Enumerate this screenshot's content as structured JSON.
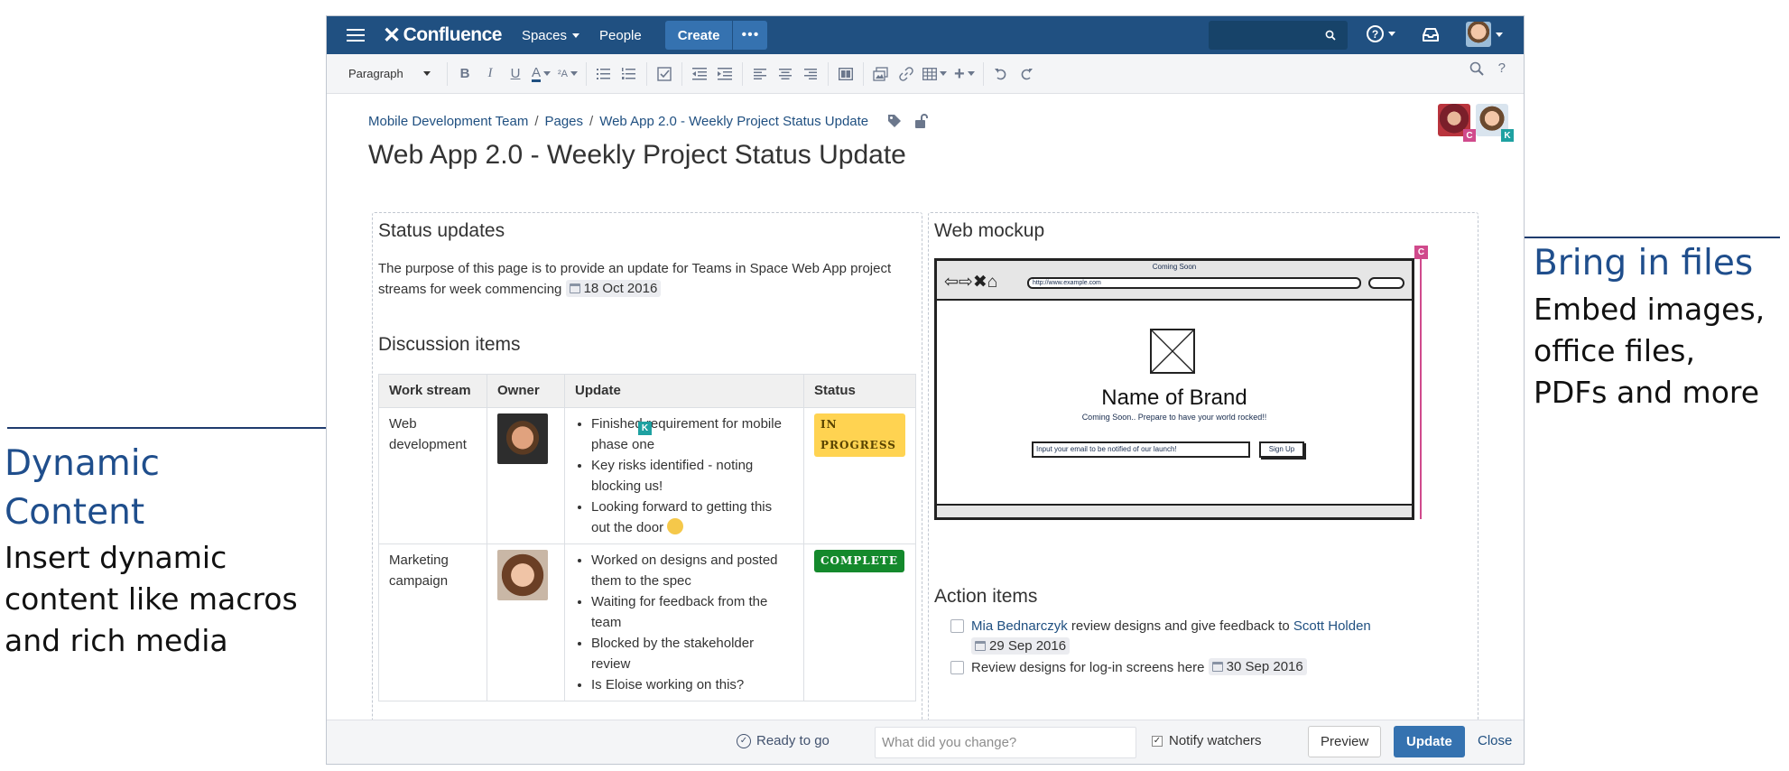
{
  "annotations": {
    "left": {
      "title_lines": [
        "Dynamic",
        "Content"
      ],
      "body_lines": [
        "Insert dynamic",
        "content like macros",
        "and rich media"
      ]
    },
    "right": {
      "title_lines": [
        "Bring in files"
      ],
      "body_lines": [
        "Embed images,",
        "office files,",
        "PDFs and more"
      ]
    }
  },
  "nav": {
    "logo": "Confluence",
    "spaces": "Spaces",
    "people": "People",
    "create": "Create",
    "more": "•••"
  },
  "toolbar": {
    "paragraph": "Paragraph"
  },
  "breadcrumb": [
    "Mobile Development Team",
    "Pages",
    "Web App 2.0 - Weekly Project Status Update"
  ],
  "collaborators": [
    {
      "initial": "C",
      "color": "#d04a8c"
    },
    {
      "initial": "K",
      "color": "#1ea1a1"
    }
  ],
  "page": {
    "title": "Web App 2.0 - Weekly Project Status Update"
  },
  "status_updates": {
    "heading": "Status updates",
    "text": "The purpose of this page is to provide an update for Teams in Space Web App project streams for week commencing",
    "date": "18 Oct 2016"
  },
  "discussion": {
    "heading": "Discussion items",
    "headers": [
      "Work stream",
      "Owner",
      "Update",
      "Status"
    ],
    "rows": [
      {
        "stream": "Web development",
        "updates": [
          "Finished requirement for mobile phase one",
          "Key risks identified - noting blocking us!",
          "Looking forward to getting this out the door"
        ],
        "status": "IN PROGRESS",
        "status_bg": "#ffd351",
        "status_fg": "#594300"
      },
      {
        "stream": "Marketing campaign",
        "updates": [
          "Worked on designs and posted them to the spec",
          "Waiting for feedback from the team",
          "Blocked by the stakeholder review",
          "Is Eloise working on this?"
        ],
        "status": "COMPLETE",
        "status_bg": "#14892c",
        "status_fg": "#ffffff"
      }
    ]
  },
  "web_mockup": {
    "heading": "Web mockup",
    "cursor_tag": "C",
    "coming_soon": "Coming Soon",
    "url": "http://www.example.com",
    "brand": "Name of Brand",
    "subtitle": "Coming Soon.. Prepare to have your world rocked!!",
    "email_placeholder": "Input your email to be notified of our launch!",
    "signup": "Sign Up"
  },
  "action_items": {
    "heading": "Action items",
    "item1": {
      "person1": "Mia Bednarczyk",
      "mid": "review designs and give feedback to",
      "person2": "Scott Holden",
      "date": "29 Sep 2016"
    },
    "item2": {
      "text": "Review designs for log-in screens here",
      "date": "30 Sep 2016"
    }
  },
  "footer": {
    "ready": "Ready to go",
    "change_placeholder": "What did you change?",
    "notify": "Notify watchers",
    "preview": "Preview",
    "update": "Update",
    "close": "Close"
  },
  "colors": {
    "nav_bg": "#205081",
    "accent": "#3572b0",
    "annotation_title": "#1f4e8c"
  }
}
